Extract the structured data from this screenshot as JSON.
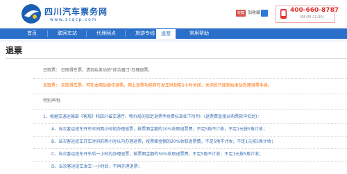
{
  "header": {
    "brand": "四川汽车票务网",
    "domain": "www.scqcp.com",
    "favorite_badge": "收藏",
    "favorite_label": "加收藏",
    "home_label": "首页",
    "hotline_phone": "400-660-8787",
    "hotline_hours": "(08:00-21:30)"
  },
  "nav": {
    "items": [
      "首页",
      "联网车站",
      "代理网点",
      "旅游专线",
      "退票",
      "常用帮助"
    ],
    "active": "退票"
  },
  "page": {
    "title": "退票",
    "taken_ticket": "已取票：   已取得车票，请到始发站的\"综合窗口\"办理退票。",
    "untaken_ticket": "未取票：   未取得车票，可在本网站操作退票。网上退票功能将在发车时刻前2小时关闭，关闭后只能到始发站办理退票手续。",
    "special_note": "特别声明:",
    "rule_1": "1、根据交通运输部《客规》和四川省交通厅、物价局的规定退票手续费标准如下所列：(退票费直接从购票款中扣划)：",
    "rule_a": "A、当次客运班车开车时间两小时前办理退票，按票面金额的10%收取退票费，不足5角不计收，不足1元按5角计收；",
    "rule_b": "B、当次客运班车开车时间前两小时以内办理退票，按票面金额的20%收取退票费，不足5角不计收，不足1元按5角计收；",
    "rule_c": "C、当次客运班车开车后一小时内办理退票，按票面金额的50%收取退票费，不足5角不计收，不足1元按5角计收；",
    "rule_d": "D、当次客运班车发车一小时后，不再办理退票；"
  },
  "colors": {
    "nav_bg": "#2a6fc9",
    "brand_blue": "#1a5fb4",
    "warning_orange": "#ff6a00",
    "hotline_red": "#e03131"
  }
}
